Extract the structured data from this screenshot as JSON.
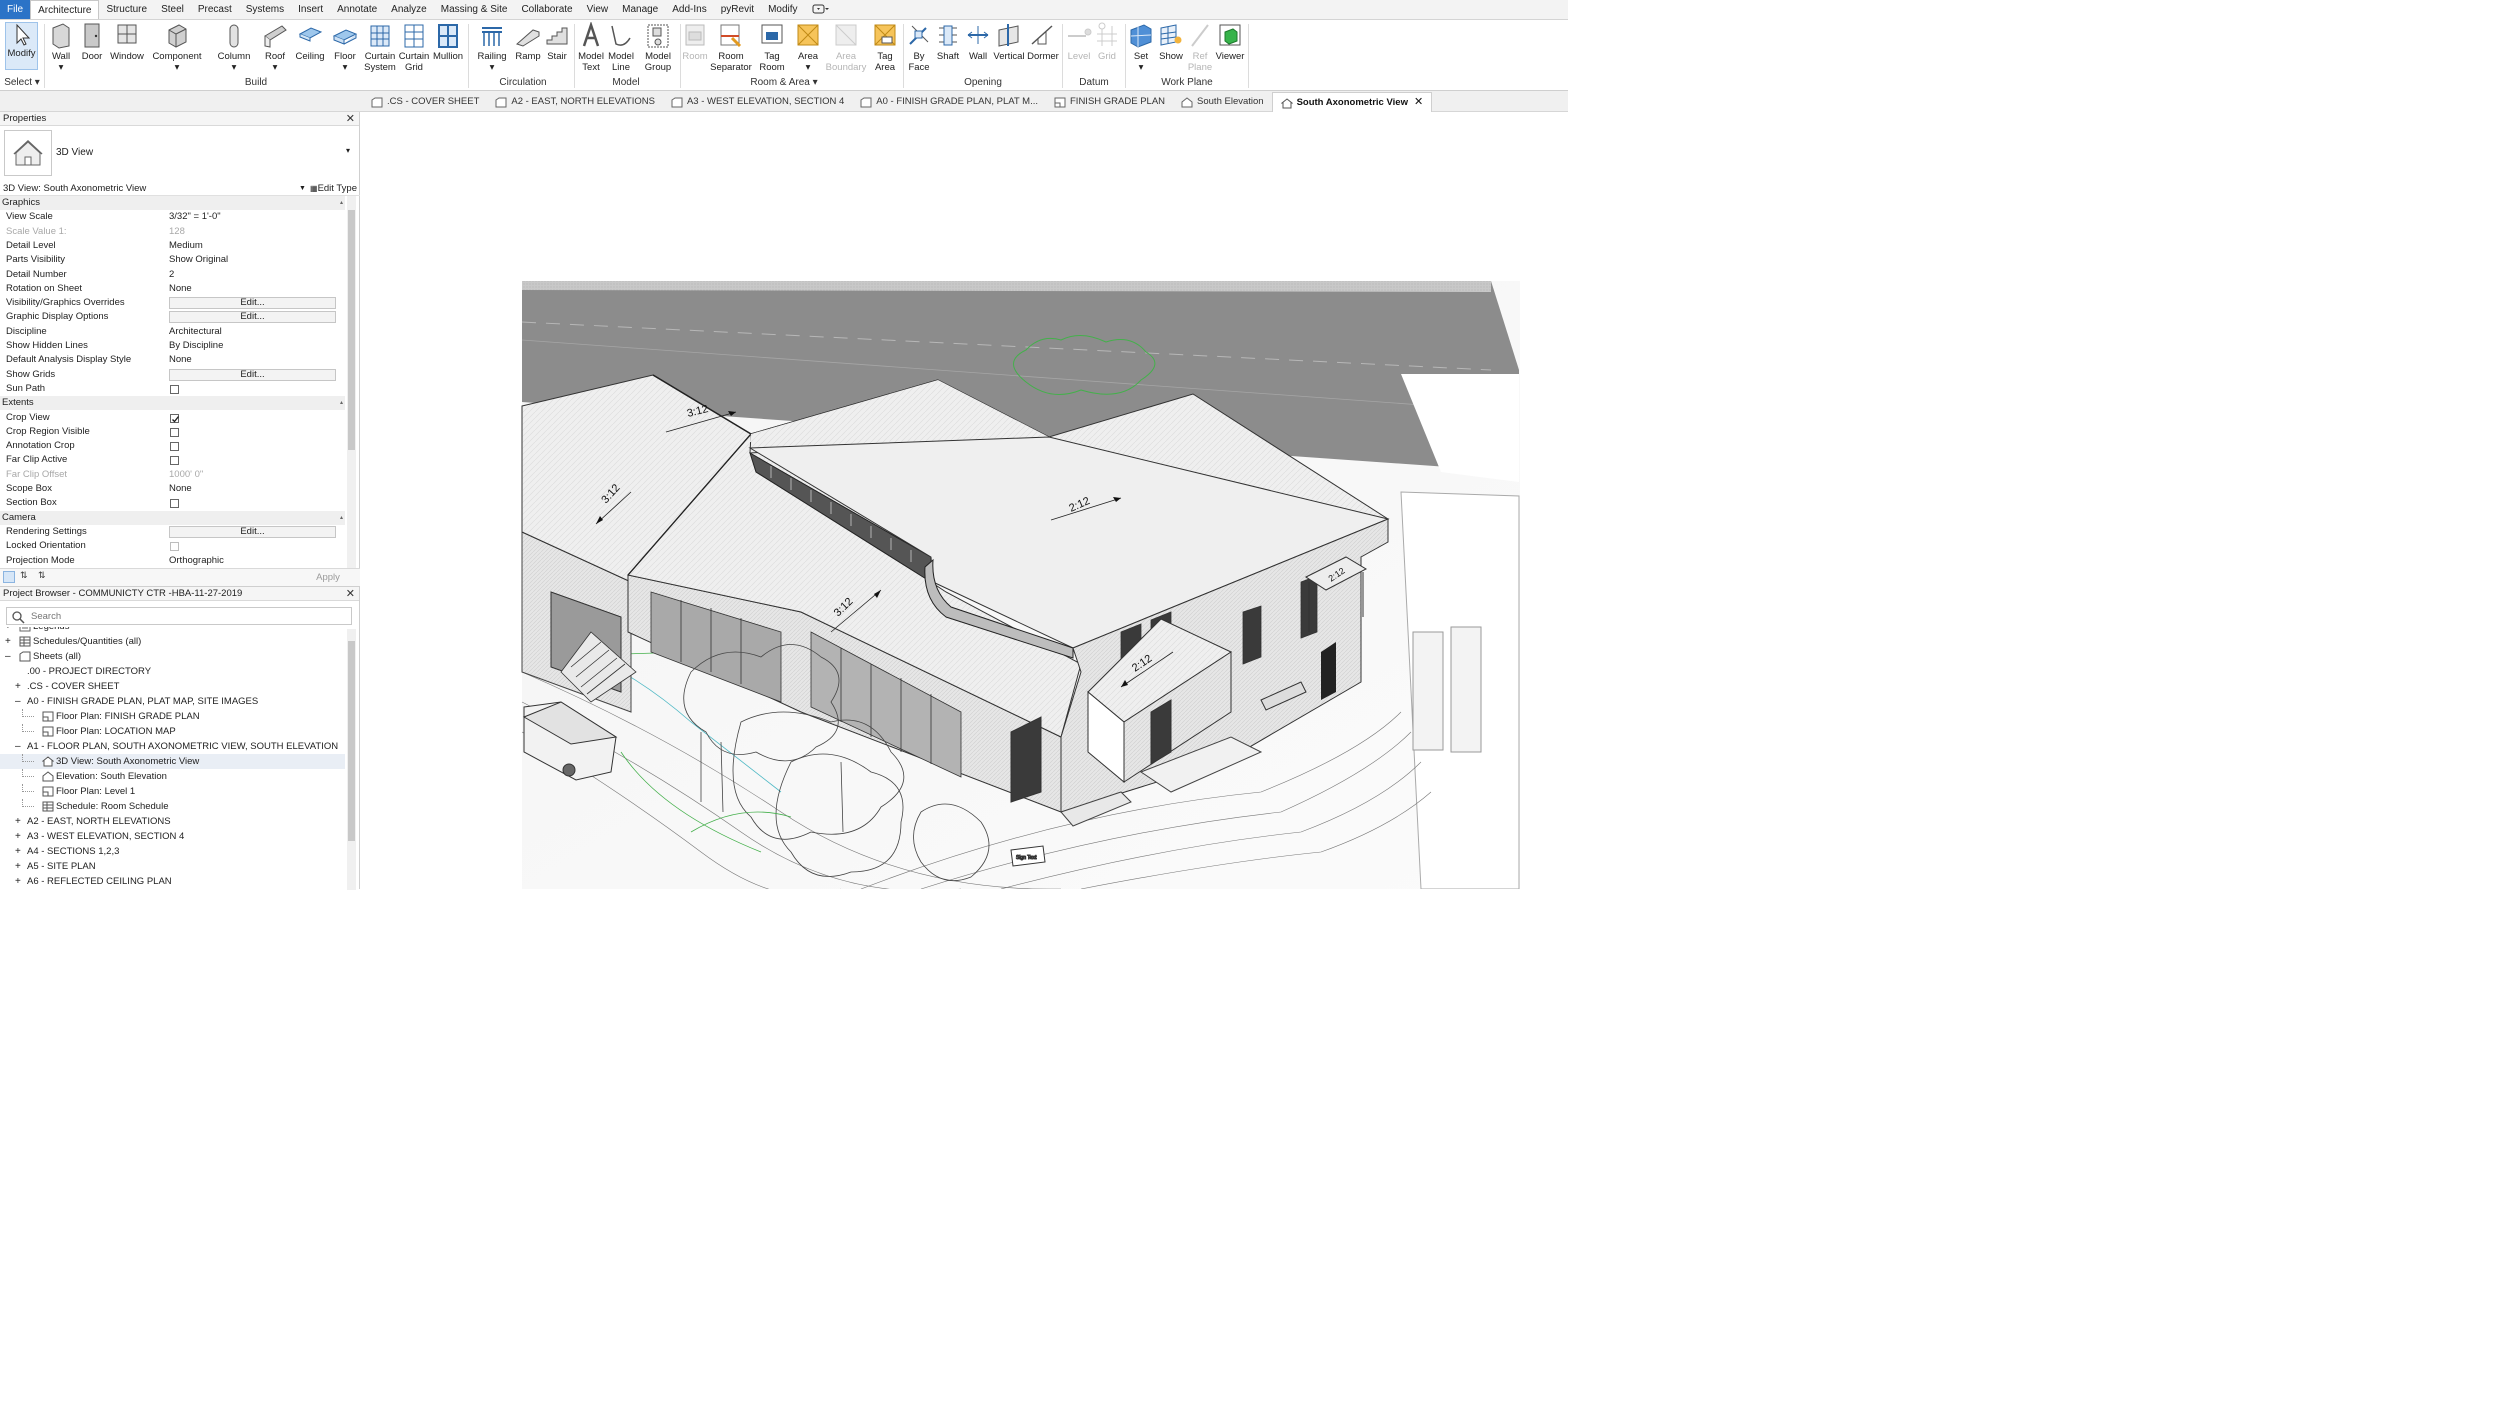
{
  "menu": [
    "File",
    "Architecture",
    "Structure",
    "Steel",
    "Precast",
    "Systems",
    "Insert",
    "Annotate",
    "Analyze",
    "Massing & Site",
    "Collaborate",
    "View",
    "Manage",
    "Add-Ins",
    "pyRevit",
    "Modify"
  ],
  "ribbon": {
    "tools": {
      "modify": "Modify",
      "wall": "Wall",
      "door": "Door",
      "window": "Window",
      "component": "Component",
      "column": "Column",
      "roof": "Roof",
      "ceiling": "Ceiling",
      "floor": "Floor",
      "curtain_system_1": "Curtain",
      "curtain_system_2": "System",
      "curtain_grid_1": "Curtain",
      "curtain_grid_2": "Grid",
      "mullion": "Mullion",
      "railing": "Railing",
      "ramp": "Ramp",
      "stair": "Stair",
      "model_text_1": "Model",
      "model_text_2": "Text",
      "model_line_1": "Model",
      "model_line_2": "Line",
      "model_group_1": "Model",
      "model_group_2": "Group",
      "room": "Room",
      "room_separator_1": "Room",
      "room_separator_2": "Separator",
      "tag_room_1": "Tag",
      "tag_room_2": "Room",
      "area": "Area",
      "area_boundary_1": "Area",
      "area_boundary_2": "Boundary",
      "tag_area_1": "Tag",
      "tag_area_2": "Area",
      "by_face_1": "By",
      "by_face_2": "Face",
      "shaft": "Shaft",
      "op_wall": "Wall",
      "vertical": "Vertical",
      "dormer": "Dormer",
      "level": "Level",
      "grid": "Grid",
      "set": "Set",
      "show": "Show",
      "ref_plane_1": "Ref",
      "ref_plane_2": "Plane",
      "viewer": "Viewer"
    },
    "groups": {
      "select": "Select",
      "build": "Build",
      "circulation": "Circulation",
      "model": "Model",
      "room_area": "Room & Area",
      "opening": "Opening",
      "datum": "Datum",
      "work_plane": "Work Plane"
    }
  },
  "properties": {
    "title": "Properties",
    "type_name": "3D View",
    "instance_selector": "3D View: South Axonometric View",
    "edit_type": "Edit Type",
    "apply": "Apply",
    "rows": [
      {
        "type": "cat",
        "k": "Graphics"
      },
      {
        "type": "val",
        "k": "View Scale",
        "v": "3/32\" = 1'-0\""
      },
      {
        "type": "dis",
        "k": "Scale Value    1:",
        "v": "128"
      },
      {
        "type": "val",
        "k": "Detail Level",
        "v": "Medium"
      },
      {
        "type": "val",
        "k": "Parts Visibility",
        "v": "Show Original"
      },
      {
        "type": "val",
        "k": "Detail Number",
        "v": "2"
      },
      {
        "type": "val",
        "k": "Rotation on Sheet",
        "v": "None"
      },
      {
        "type": "btn",
        "k": "Visibility/Graphics Overrides",
        "v": "Edit..."
      },
      {
        "type": "btn",
        "k": "Graphic Display Options",
        "v": "Edit..."
      },
      {
        "type": "val",
        "k": "Discipline",
        "v": "Architectural"
      },
      {
        "type": "val",
        "k": "Show Hidden Lines",
        "v": "By Discipline"
      },
      {
        "type": "val",
        "k": "Default Analysis Display Style",
        "v": "None"
      },
      {
        "type": "btn",
        "k": "Show Grids",
        "v": "Edit..."
      },
      {
        "type": "cb",
        "k": "Sun Path",
        "checked": false
      },
      {
        "type": "cat",
        "k": "Extents"
      },
      {
        "type": "cb",
        "k": "Crop View",
        "checked": true
      },
      {
        "type": "cb",
        "k": "Crop Region Visible",
        "checked": false
      },
      {
        "type": "cb",
        "k": "Annotation Crop",
        "checked": false
      },
      {
        "type": "cb",
        "k": "Far Clip Active",
        "checked": false
      },
      {
        "type": "dis",
        "k": "Far Clip Offset",
        "v": "1000'  0\""
      },
      {
        "type": "val",
        "k": "Scope Box",
        "v": "None"
      },
      {
        "type": "cb",
        "k": "Section Box",
        "checked": false
      },
      {
        "type": "cat",
        "k": "Camera"
      },
      {
        "type": "btn",
        "k": "Rendering Settings",
        "v": "Edit..."
      },
      {
        "type": "cbdis",
        "k": "Locked Orientation",
        "checked": false
      },
      {
        "type": "val",
        "k": "Projection Mode",
        "v": "Orthographic"
      }
    ]
  },
  "browser": {
    "title": "Project Browser - COMMUNICTY CTR -HBA-11-27-2019",
    "search_placeholder": "Search",
    "items": [
      {
        "lvl": 1,
        "exp": "+",
        "icon": "legend",
        "label": "Legends"
      },
      {
        "lvl": 1,
        "exp": "+",
        "icon": "schedule",
        "label": "Schedules/Quantities (all)"
      },
      {
        "lvl": 1,
        "exp": "-",
        "icon": "sheet",
        "label": "Sheets (all)"
      },
      {
        "lvl": 2,
        "exp": "",
        "icon": "",
        "label": ".00 - PROJECT DIRECTORY"
      },
      {
        "lvl": 2,
        "exp": "+",
        "icon": "",
        "label": ".CS - COVER SHEET"
      },
      {
        "lvl": 2,
        "exp": "-",
        "icon": "",
        "label": "A0 - FINISH GRADE PLAN, PLAT MAP, SITE IMAGES"
      },
      {
        "lvl": 3,
        "exp": "",
        "icon": "plan",
        "label": "Floor Plan: FINISH GRADE PLAN"
      },
      {
        "lvl": 3,
        "exp": "",
        "icon": "plan",
        "label": "Floor Plan: LOCATION MAP"
      },
      {
        "lvl": 2,
        "exp": "-",
        "icon": "",
        "label": "A1 - FLOOR PLAN, SOUTH AXONOMETRIC VIEW, SOUTH ELEVATION"
      },
      {
        "lvl": 3,
        "exp": "",
        "icon": "house",
        "label": "3D View: South Axonometric View",
        "hl": true
      },
      {
        "lvl": 3,
        "exp": "",
        "icon": "elev",
        "label": "Elevation: South Elevation"
      },
      {
        "lvl": 3,
        "exp": "",
        "icon": "plan",
        "label": "Floor Plan: Level 1"
      },
      {
        "lvl": 3,
        "exp": "",
        "icon": "schedule",
        "label": "Schedule: Room Schedule"
      },
      {
        "lvl": 2,
        "exp": "+",
        "icon": "",
        "label": "A2 - EAST, NORTH ELEVATIONS"
      },
      {
        "lvl": 2,
        "exp": "+",
        "icon": "",
        "label": "A3 - WEST ELEVATION, SECTION 4"
      },
      {
        "lvl": 2,
        "exp": "+",
        "icon": "",
        "label": "A4 - SECTIONS 1,2,3"
      },
      {
        "lvl": 2,
        "exp": "+",
        "icon": "",
        "label": "A5 - SITE PLAN"
      },
      {
        "lvl": 2,
        "exp": "+",
        "icon": "",
        "label": "A6 - REFLECTED CEILING PLAN"
      }
    ]
  },
  "view_tabs": [
    {
      "label": ".CS - COVER SHEET",
      "icon": "sheet"
    },
    {
      "label": "A2 - EAST, NORTH ELEVATIONS",
      "icon": "sheet"
    },
    {
      "label": "A3 - WEST ELEVATION, SECTION 4",
      "icon": "sheet"
    },
    {
      "label": "A0 - FINISH GRADE PLAN, PLAT M...",
      "icon": "sheet"
    },
    {
      "label": "FINISH GRADE PLAN",
      "icon": "plan"
    },
    {
      "label": "South Elevation",
      "icon": "elev"
    },
    {
      "label": "South Axonometric View",
      "icon": "house",
      "active": true
    }
  ],
  "view": {
    "slope_labels": [
      "3:12",
      "3:12",
      "2:12",
      "3:12",
      "2:12",
      "2:12"
    ],
    "sign_text": "Sign Text"
  }
}
